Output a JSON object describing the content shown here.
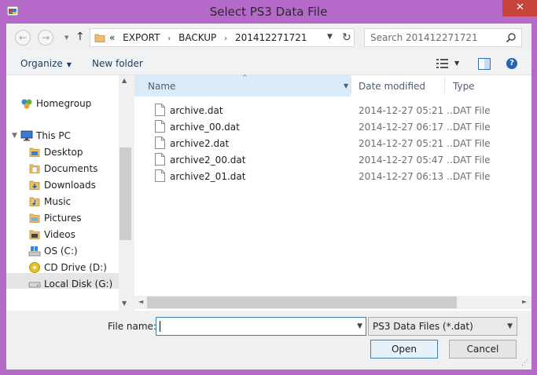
{
  "window": {
    "title": "Select PS3 Data File",
    "close_label": "✕"
  },
  "nav": {
    "back_glyph": "←",
    "forward_glyph": "→",
    "up_glyph": "↑",
    "breadcrumb_prefix": "«",
    "breadcrumbs": [
      "EXPORT",
      "BACKUP",
      "201412271721"
    ],
    "crumb_separator": "›",
    "refresh_glyph": "↻",
    "search_placeholder": "Search 201412271721"
  },
  "toolbar": {
    "organize_label": "Organize",
    "organize_arrow": "▼",
    "new_folder_label": "New folder",
    "views_arrow": "▼",
    "help_label": "?"
  },
  "sidebar": {
    "scroll_up": "▲",
    "scroll_down": "▼",
    "items": [
      {
        "label": "Homegroup",
        "icon": "homegroup-icon"
      },
      {
        "label": "This PC",
        "icon": "computer-icon"
      },
      {
        "label": "Desktop",
        "icon": "folder-icon"
      },
      {
        "label": "Documents",
        "icon": "folder-icon"
      },
      {
        "label": "Downloads",
        "icon": "folder-icon"
      },
      {
        "label": "Music",
        "icon": "folder-icon"
      },
      {
        "label": "Pictures",
        "icon": "folder-icon"
      },
      {
        "label": "Videos",
        "icon": "folder-icon"
      },
      {
        "label": "OS (C:)",
        "icon": "drive-icon"
      },
      {
        "label": "CD Drive (D:)",
        "icon": "cd-drive-icon"
      },
      {
        "label": "Local Disk (G:)",
        "icon": "disk-icon"
      }
    ]
  },
  "files": {
    "columns": {
      "name": "Name",
      "date": "Date modified",
      "type": "Type"
    },
    "sort_glyph": "^",
    "name_dd": "▼",
    "rows": [
      {
        "name": "archive.dat",
        "date": "2014-12-27 05:21 ...",
        "type": "DAT File"
      },
      {
        "name": "archive_00.dat",
        "date": "2014-12-27 06:17 ...",
        "type": "DAT File"
      },
      {
        "name": "archive2.dat",
        "date": "2014-12-27 05:21 ...",
        "type": "DAT File"
      },
      {
        "name": "archive2_00.dat",
        "date": "2014-12-27 05:47 ...",
        "type": "DAT File"
      },
      {
        "name": "archive2_01.dat",
        "date": "2014-12-27 06:13 ...",
        "type": "DAT File"
      }
    ],
    "hscroll_left": "◄",
    "hscroll_right": "►"
  },
  "footer": {
    "file_name_label": "File name:",
    "file_name_value": "",
    "file_name_dd": "▼",
    "file_type_value": "PS3 Data Files (*.dat)",
    "file_type_dd": "▼",
    "open_label": "Open",
    "cancel_label": "Cancel",
    "grip": "⋰"
  },
  "colors": {
    "frame": "#b569c9",
    "close": "#c7443b",
    "link_text": "#1e395b",
    "header_highlight": "#d9ebf9",
    "selected_nav": "#e5e5e5"
  }
}
